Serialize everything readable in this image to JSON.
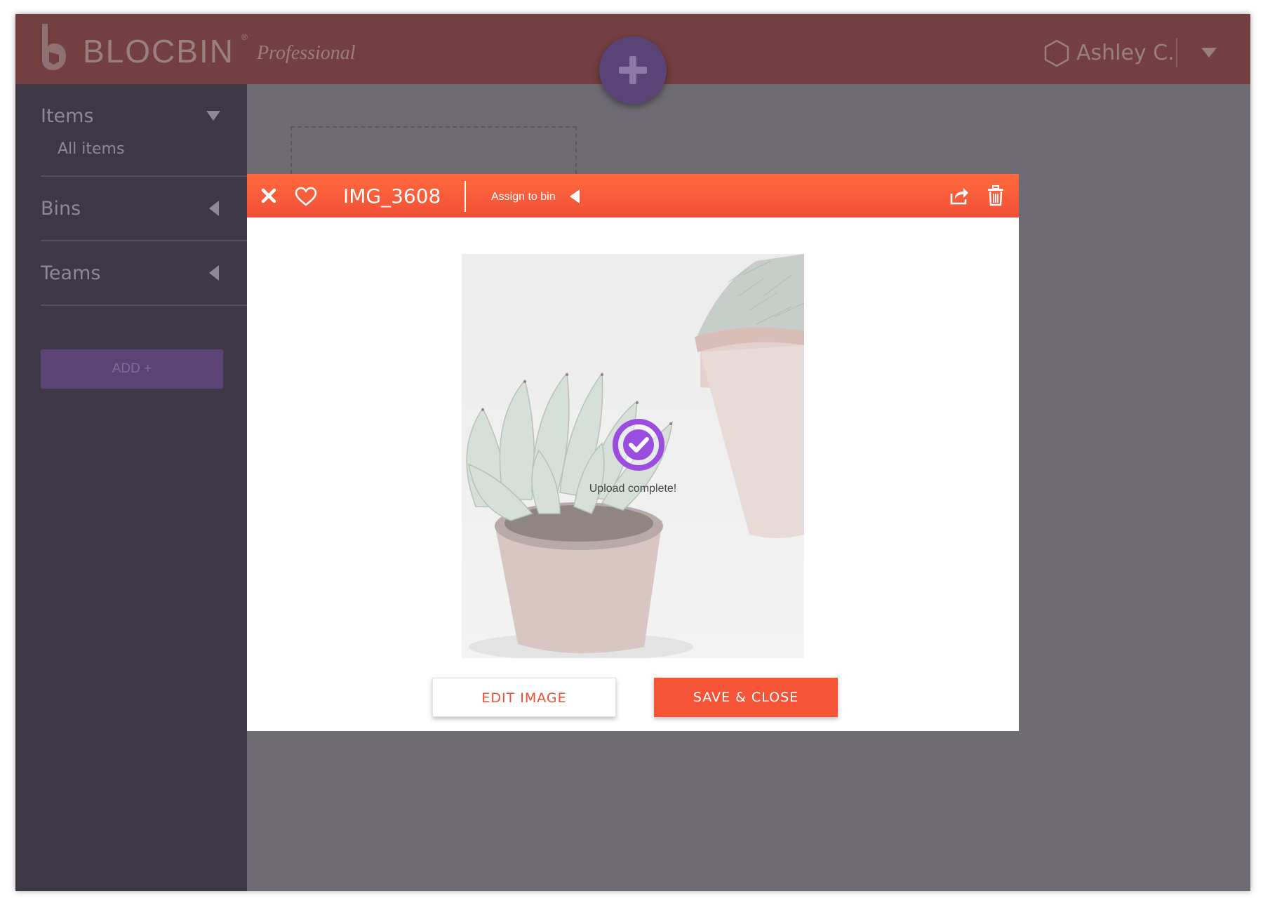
{
  "app": {
    "brand_name": "BLOCBIN",
    "brand_reg": "®",
    "edition": "Professional"
  },
  "header": {
    "user_name": "Ashley C."
  },
  "sidebar": {
    "sections": [
      {
        "label": "Items",
        "sub_items": [
          "All items"
        ]
      },
      {
        "label": "Bins"
      },
      {
        "label": "Teams"
      }
    ],
    "add_button_label": "ADD +"
  },
  "modal": {
    "file_title": "IMG_3608",
    "assign_label": "Assign to bin",
    "upload_status": "Upload complete!",
    "edit_button_label": "EDIT IMAGE",
    "save_button_label": "SAVE & CLOSE"
  },
  "colors": {
    "topbar": "#733f40",
    "sidebar": "#3d3746",
    "accent_orange": "#f55437",
    "accent_purple": "#9b4de0"
  },
  "icons": [
    "logo-icon",
    "plus-icon",
    "hexagon-user-icon",
    "chevron-down-icon",
    "close-icon",
    "heart-icon",
    "caret-left-icon",
    "share-icon",
    "trash-icon",
    "check-circle-icon"
  ]
}
